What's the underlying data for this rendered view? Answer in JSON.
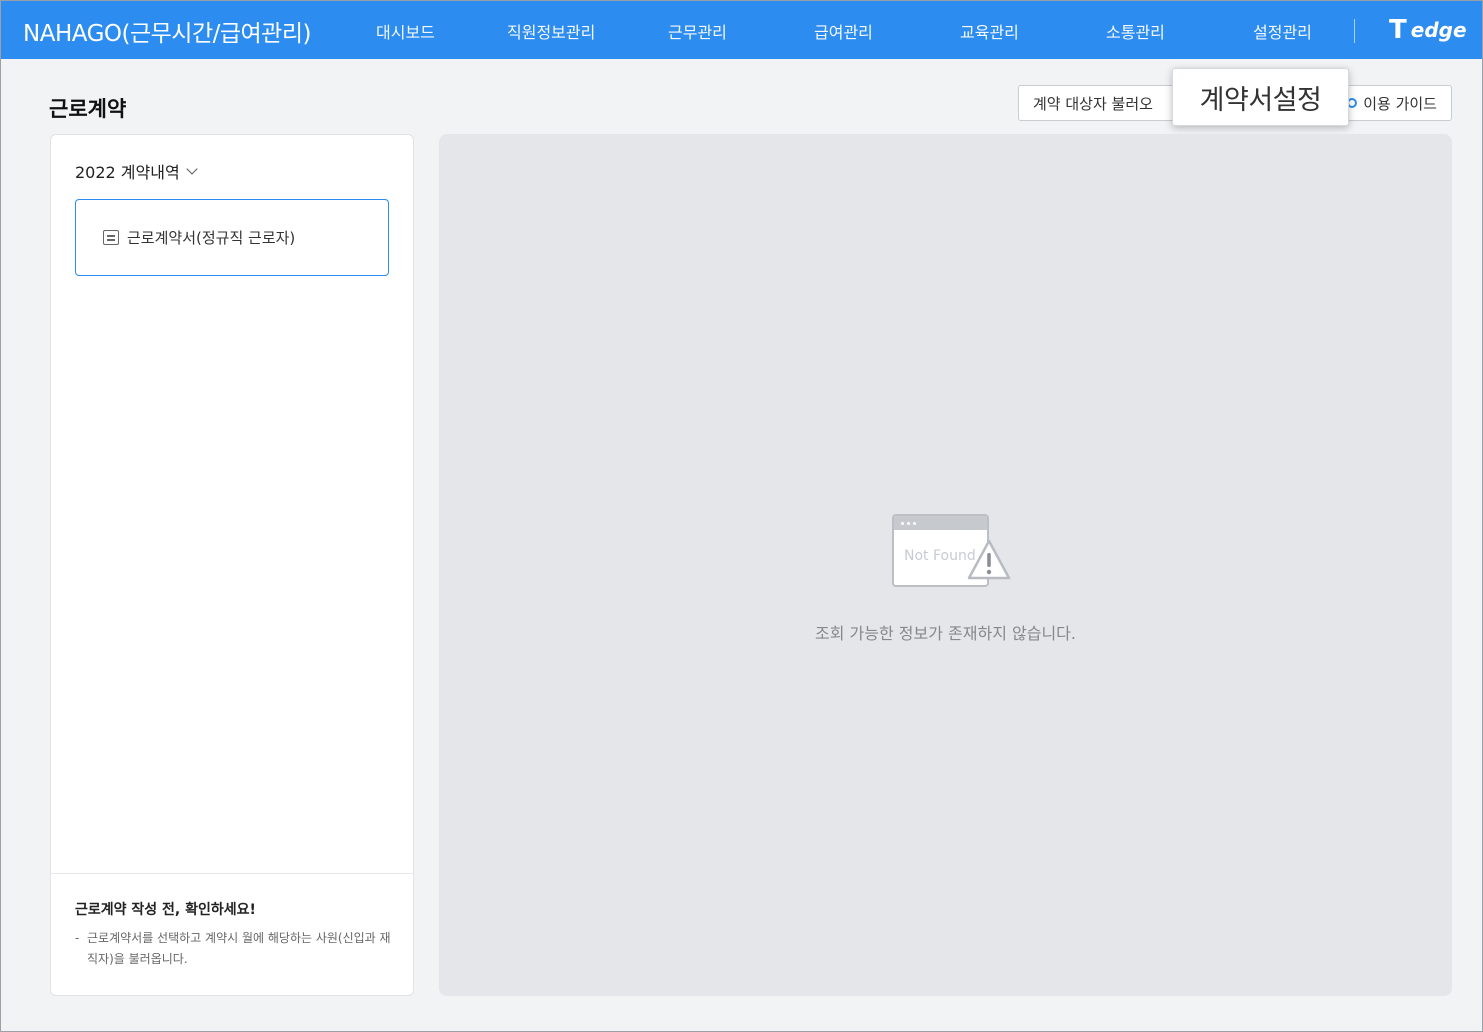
{
  "header": {
    "brand": "NAHAGO(근무시간/급여관리)",
    "nav": [
      "대시보드",
      "직원정보관리",
      "근무관리",
      "급여관리",
      "교육관리",
      "소통관리",
      "설정관리"
    ],
    "partner_logo_text": "edge"
  },
  "page": {
    "title": "근로계약",
    "load_button": "계약 대상자 불러오",
    "guide_button": "이용 가이드",
    "tooltip_label": "계약서설정"
  },
  "sidebar": {
    "year_select": "2022 계약내역",
    "items": [
      {
        "label": "근로계약서(정규직 근로자)"
      }
    ],
    "tip_title": "근로계약 작성 전, 확인하세요!",
    "tip_dash": "-",
    "tip_body": "근로계약서를 선택하고 계약시 월에 해당하는 사원(신입과 재직자)을 불러옵니다."
  },
  "main": {
    "not_found_label": "Not Found",
    "empty_message": "조회 가능한 정보가 존재하지 않습니다."
  },
  "colors": {
    "primary": "#2d8cf0",
    "background": "#f2f3f5",
    "panel_empty": "#e4e6ea"
  }
}
